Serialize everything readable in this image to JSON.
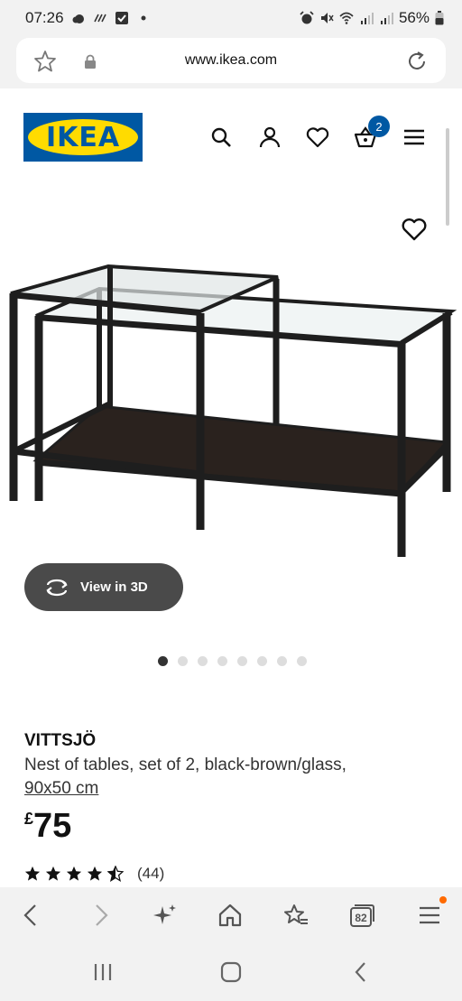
{
  "status": {
    "time": "07:26",
    "battery": "56%"
  },
  "browser": {
    "url": "www.ikea.com",
    "tab_count": "82"
  },
  "header": {
    "logo_text": "IKEA",
    "cart_badge": "2"
  },
  "colors": {
    "ikea_blue": "#0058a3",
    "ikea_yellow": "#ffdb00",
    "pill_bg": "#4a4a4a",
    "notification": "#ff6a00"
  },
  "icons": [
    "search-icon",
    "account-icon",
    "heart-icon",
    "basket-icon",
    "hamburger-icon",
    "star-icon",
    "lock-icon",
    "reload-icon",
    "rotate-3d-icon",
    "back-icon",
    "forward-icon",
    "sparkle-icon",
    "home-icon",
    "bookmarks-icon",
    "tabs-icon",
    "menu-icon"
  ],
  "product": {
    "view_3d_label": "View in 3D",
    "image_count": 8,
    "active_image": 1,
    "name": "VITTSJÖ",
    "description": "Nest of tables, set of 2, black-brown/glass,",
    "size": "90x50 cm",
    "currency": "£",
    "price": "75",
    "rating": 4.5,
    "rating_max": 5,
    "review_count": "(44)"
  }
}
